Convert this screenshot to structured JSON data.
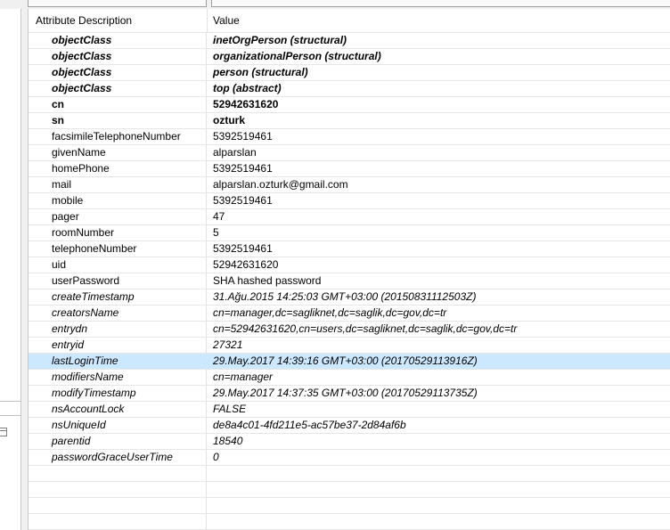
{
  "header": {
    "attribute": "Attribute Description",
    "value": "Value"
  },
  "rows": [
    {
      "attr": "objectClass",
      "value": "inetOrgPerson (structural)",
      "style": "bolditalic"
    },
    {
      "attr": "objectClass",
      "value": "organizationalPerson (structural)",
      "style": "bolditalic"
    },
    {
      "attr": "objectClass",
      "value": "person (structural)",
      "style": "bolditalic"
    },
    {
      "attr": "objectClass",
      "value": "top (abstract)",
      "style": "bolditalic"
    },
    {
      "attr": "cn",
      "value": "52942631620",
      "style": "bold"
    },
    {
      "attr": "sn",
      "value": "ozturk",
      "style": "bold"
    },
    {
      "attr": "facsimileTelephoneNumber",
      "value": "5392519461",
      "style": "normal"
    },
    {
      "attr": "givenName",
      "value": "alparslan",
      "style": "normal"
    },
    {
      "attr": "homePhone",
      "value": "5392519461",
      "style": "normal"
    },
    {
      "attr": "mail",
      "value": "alparslan.ozturk@gmail.com",
      "style": "normal"
    },
    {
      "attr": "mobile",
      "value": "5392519461",
      "style": "normal"
    },
    {
      "attr": "pager",
      "value": "47",
      "style": "normal"
    },
    {
      "attr": "roomNumber",
      "value": "5",
      "style": "normal"
    },
    {
      "attr": "telephoneNumber",
      "value": "5392519461",
      "style": "normal"
    },
    {
      "attr": "uid",
      "value": "52942631620",
      "style": "normal"
    },
    {
      "attr": "userPassword",
      "value": "SHA hashed password",
      "style": "normal"
    },
    {
      "attr": "createTimestamp",
      "value": "31.Ağu.2015 14:25:03 GMT+03:00 (20150831112503Z)",
      "style": "italic"
    },
    {
      "attr": "creatorsName",
      "value": "cn=manager,dc=sagliknet,dc=saglik,dc=gov,dc=tr",
      "style": "italic"
    },
    {
      "attr": "entrydn",
      "value": "cn=52942631620,cn=users,dc=sagliknet,dc=saglik,dc=gov,dc=tr",
      "style": "italic"
    },
    {
      "attr": "entryid",
      "value": "27321",
      "style": "italic"
    },
    {
      "attr": "lastLoginTime",
      "value": "29.May.2017 14:39:16 GMT+03:00 (20170529113916Z)",
      "style": "italic",
      "selected": true
    },
    {
      "attr": "modifiersName",
      "value": "cn=manager",
      "style": "italic"
    },
    {
      "attr": "modifyTimestamp",
      "value": "29.May.2017 14:37:35 GMT+03:00 (20170529113735Z)",
      "style": "italic"
    },
    {
      "attr": "nsAccountLock",
      "value": "FALSE",
      "style": "italic"
    },
    {
      "attr": "nsUniqueId",
      "value": "de8a4c01-4fd211e5-ac57be37-2d84af6b",
      "style": "italic"
    },
    {
      "attr": "parentid",
      "value": "18540",
      "style": "italic"
    },
    {
      "attr": "passwordGraceUserTime",
      "value": "0",
      "style": "italic"
    },
    {
      "attr": "",
      "value": "",
      "style": "empty"
    },
    {
      "attr": "",
      "value": "",
      "style": "empty"
    },
    {
      "attr": "",
      "value": "",
      "style": "empty"
    },
    {
      "attr": "",
      "value": "",
      "style": "empty"
    }
  ]
}
